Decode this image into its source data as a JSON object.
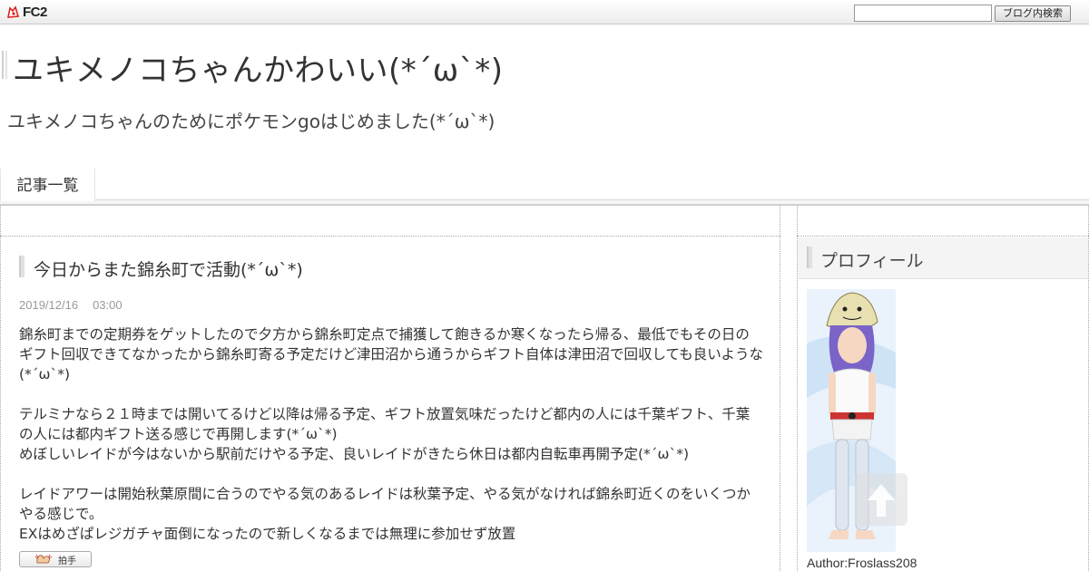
{
  "fc2_bar": {
    "logo_text": "FC2",
    "search_placeholder": "",
    "search_button_label": "ブログ内検索"
  },
  "blog": {
    "title": "ユキメノコちゃんかわいい(*´ω`*)",
    "description": "ユキメノコちゃんのためにポケモンgoはじめました(*´ω`*)"
  },
  "nav": {
    "tabs": [
      {
        "label": "記事一覧"
      }
    ]
  },
  "entry": {
    "title": "今日からまた錦糸町で活動(*´ω`*)",
    "date": "2019/12/16",
    "time": "03:00",
    "paragraphs": [
      "錦糸町までの定期券をゲットしたので夕方から錦糸町定点で捕獲して飽きるか寒くなったら帰る、最低でもその日のギフト回収できてなかったから錦糸町寄る予定だけど津田沼から通うからギフト自体は津田沼で回収しても良いような(*´ω`*)",
      "テルミナなら２１時までは開いてるけど以降は帰る予定、ギフト放置気味だったけど都内の人には千葉ギフト、千葉の人には都内ギフト送る感じで再開します(*´ω`*)\nめぼしいレイドが今はないから駅前だけやる予定、良いレイドがきたら休日は都内自転車再開予定(*´ω`*)",
      "レイドアワーは開始秋葉原間に合うのでやる気のあるレイドは秋葉予定、やる気がなければ錦糸町近くのをいくつかやる感じで。\nEXはめざぱレジガチャ面倒になったので新しくなるまでは無理に参加せず放置"
    ],
    "clap_label": "拍手"
  },
  "sidebar": {
    "profile_heading": "プロフィール",
    "author": "Author:Froslass208"
  },
  "colors": {
    "text": "#333333",
    "date": "#999999",
    "header_gray": "#f4f4f4"
  }
}
